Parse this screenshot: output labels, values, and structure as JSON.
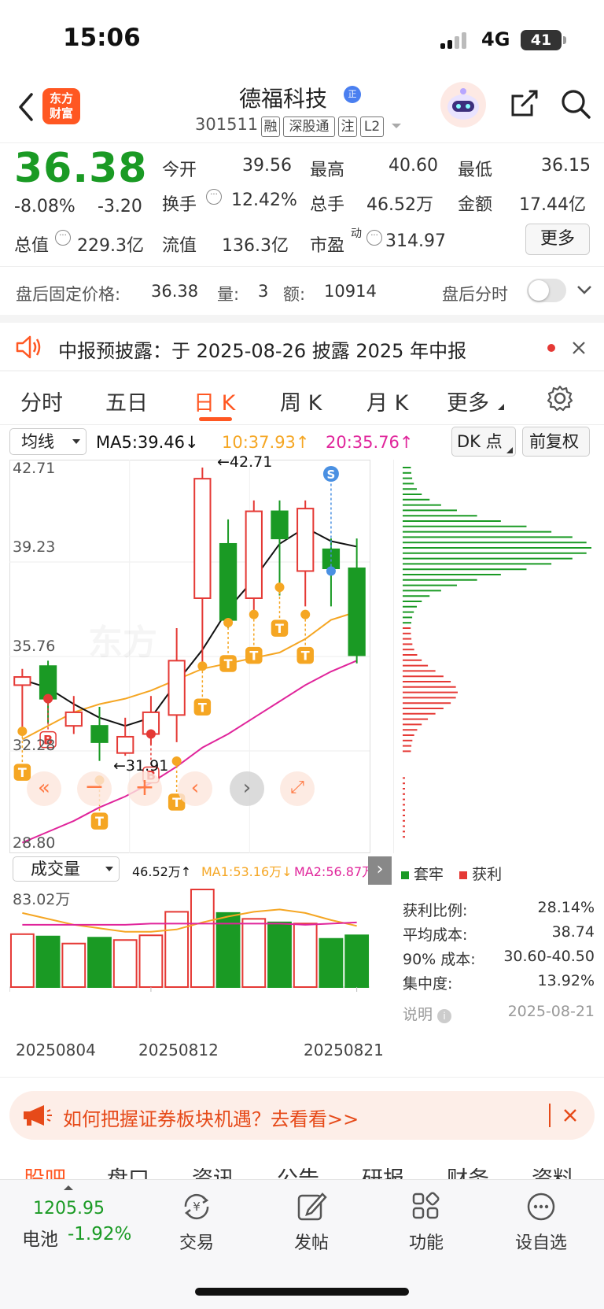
{
  "status_bar": {
    "time": "15:06",
    "network": "4G",
    "battery": "41"
  },
  "header": {
    "logo_text_line1": "东方",
    "logo_text_line2": "财富",
    "stock_name": "德福科技",
    "name_badge": "正",
    "stock_code": "301511",
    "tags": [
      "融",
      "深股通",
      "注",
      "L2"
    ]
  },
  "quote": {
    "price": "36.38",
    "change_pct": "-8.08%",
    "change_amt": "-3.20",
    "total_value_label": "总值",
    "total_value": "229.3亿",
    "open_label": "今开",
    "open": "39.56",
    "high_label": "最高",
    "high": "40.60",
    "low_label": "最低",
    "low": "36.15",
    "turnover_label": "换手",
    "turnover": "12.42%",
    "volume_label": "总手",
    "volume": "46.52万",
    "amount_label": "金额",
    "amount": "17.44亿",
    "float_value_label": "流值",
    "float_value": "136.3亿",
    "pe_label": "市盈",
    "pe_super": "动",
    "pe": "314.97",
    "more_button": "更多"
  },
  "after_hours": {
    "price_label": "盘后固定价格:",
    "price": "36.38",
    "qty_label": "量:",
    "qty": "3",
    "amt_label": "额:",
    "amt": "10914",
    "toggle_label": "盘后分时"
  },
  "notice": {
    "text": "中报预披露：于 2025-08-26 披露 2025 年中报"
  },
  "tabs": [
    {
      "label": "分时"
    },
    {
      "label": "五日"
    },
    {
      "label": "日 K"
    },
    {
      "label": "周 K"
    },
    {
      "label": "月 K"
    },
    {
      "label": "更多"
    }
  ],
  "ma_bar": {
    "selector": "均线",
    "ma5": "MA5:39.46↓",
    "ma10": "10:37.93↑",
    "ma20": "20:35.76↑",
    "dk_button": "DK 点",
    "adjust_button": "前复权"
  },
  "colors": {
    "up": "#e53935",
    "down": "#1a9a24",
    "ma5": "#111111",
    "ma10": "#f5a623",
    "ma20": "#e0259b",
    "accent": "#ff5722"
  },
  "chart_data": {
    "type": "candlestick",
    "y_ticks": [
      "42.71",
      "39.23",
      "35.76",
      "32.28",
      "28.80"
    ],
    "ylim": [
      28.8,
      42.71
    ],
    "annotations": {
      "high": "←42.71",
      "low": "←31.91"
    },
    "candles": [
      {
        "o": 34.7,
        "c": 35.0,
        "h": 35.3,
        "l": 33.0
      },
      {
        "o": 35.4,
        "c": 34.2,
        "h": 35.6,
        "l": 33.3
      },
      {
        "o": 33.2,
        "c": 33.7,
        "h": 34.3,
        "l": 32.9
      },
      {
        "o": 33.2,
        "c": 32.6,
        "h": 33.9,
        "l": 31.91
      },
      {
        "o": 32.2,
        "c": 32.8,
        "h": 33.5,
        "l": 32.1
      },
      {
        "o": 32.9,
        "c": 33.7,
        "h": 34.3,
        "l": 32.5
      },
      {
        "o": 33.6,
        "c": 35.6,
        "h": 36.8,
        "l": 32.6
      },
      {
        "o": 37.9,
        "c": 42.3,
        "h": 42.71,
        "l": 35.4
      },
      {
        "o": 39.9,
        "c": 37.1,
        "h": 40.8,
        "l": 36.8
      },
      {
        "o": 37.9,
        "c": 41.1,
        "h": 41.5,
        "l": 37.4
      },
      {
        "o": 41.1,
        "c": 40.1,
        "h": 41.5,
        "l": 38.0
      },
      {
        "o": 38.9,
        "c": 41.2,
        "h": 41.5,
        "l": 37.6
      },
      {
        "o": 39.7,
        "c": 39.0,
        "h": 40.1,
        "l": 37.6
      },
      {
        "o": 39.0,
        "c": 35.8,
        "h": 40.1,
        "l": 35.5
      }
    ],
    "ma5": [
      34.9,
      34.6,
      34.0,
      33.5,
      33.2,
      33.5,
      34.8,
      36.0,
      37.5,
      38.6,
      39.9,
      40.5,
      40.0,
      39.8
    ],
    "ma10": [
      32.7,
      33.2,
      33.7,
      34.0,
      34.2,
      34.5,
      34.9,
      35.3,
      35.5,
      35.7,
      35.9,
      36.4,
      37.1,
      37.4
    ],
    "ma20": [
      28.9,
      29.3,
      29.7,
      30.2,
      30.6,
      31.1,
      31.7,
      32.4,
      32.9,
      33.5,
      34.1,
      34.7,
      35.2,
      35.6
    ],
    "markers": [
      {
        "i": 0,
        "v": 33.0,
        "label": "T"
      },
      {
        "i": 1,
        "v": 34.2,
        "label": "B"
      },
      {
        "i": 3,
        "v": 31.2,
        "label": "T"
      },
      {
        "i": 5,
        "v": 32.9,
        "label": "B"
      },
      {
        "i": 6,
        "v": 31.9,
        "label": "T"
      },
      {
        "i": 7,
        "v": 35.4,
        "label": "T"
      },
      {
        "i": 8,
        "v": 37.0,
        "label": "T"
      },
      {
        "i": 9,
        "v": 37.3,
        "label": "T"
      },
      {
        "i": 10,
        "v": 38.3,
        "label": "T"
      },
      {
        "i": 11,
        "v": 37.3,
        "label": "T"
      }
    ],
    "sell_marker": {
      "i": 12,
      "v": 38.9,
      "label": "S"
    },
    "volume_selector": "成交量",
    "volume_total": "46.52万↑",
    "volume_ma1": "MA1:53.16万↓",
    "volume_ma2": "MA2:56.87万",
    "volume_max_label": "83.02万",
    "volumes": [
      45,
      43,
      37,
      42,
      40,
      44,
      64,
      83,
      63,
      58,
      55,
      54,
      41,
      44
    ],
    "vol_ma1": [
      63,
      58,
      53,
      50,
      47,
      47,
      49,
      55,
      60,
      64,
      66,
      63,
      57,
      52
    ],
    "vol_ma2": [
      53,
      53,
      53,
      53,
      53,
      54,
      54,
      54,
      54,
      54,
      54,
      53,
      54,
      55
    ],
    "dates": [
      "20250804",
      "20250812",
      "20250821"
    ]
  },
  "chip": {
    "legend_trapped": "套牢",
    "legend_profit": "获利",
    "profit_ratio_label": "获利比例:",
    "profit_ratio": "28.14%",
    "avg_cost_label": "平均成本:",
    "avg_cost": "38.74",
    "cost90_label": "90% 成本:",
    "cost90": "30.60-40.50",
    "concentration_label": "集中度:",
    "concentration": "13.92%",
    "note_label": "说明",
    "date": "2025-08-21"
  },
  "banner": {
    "text": "如何把握证券板块机遇？去看看>>"
  },
  "subtabs": [
    "股吧",
    "盘口",
    "资讯",
    "公告",
    "研报",
    "财务",
    "资料"
  ],
  "bottom_nav": {
    "index_value": "1205.95",
    "index_name": "电池",
    "index_change": "-1.92%",
    "items": [
      {
        "label": "交易"
      },
      {
        "label": "发帖"
      },
      {
        "label": "功能"
      },
      {
        "label": "设自选"
      }
    ]
  }
}
